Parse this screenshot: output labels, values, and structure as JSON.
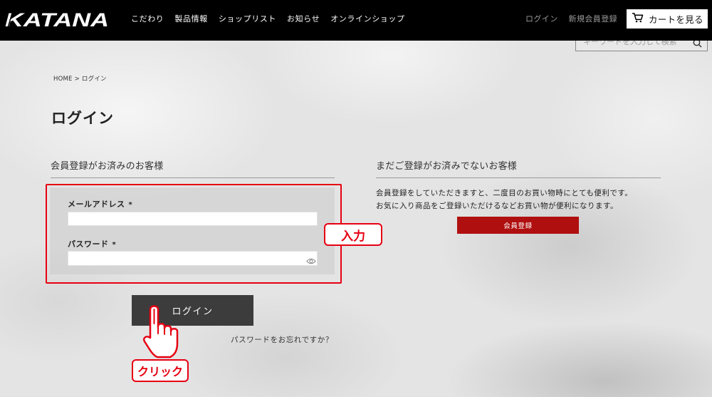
{
  "header": {
    "logo": "KATANA",
    "nav": [
      "こだわり",
      "製品情報",
      "ショップリスト",
      "お知らせ",
      "オンラインショップ"
    ],
    "login_link": "ログイン",
    "register_link": "新規会員登録",
    "cart_button": "カートを見る"
  },
  "search": {
    "placeholder": "キーワードを入力して検索"
  },
  "breadcrumb": {
    "home": "HOME",
    "separator": ">",
    "current": "ログイン"
  },
  "page_title": "ログイン",
  "member_login": {
    "heading": "会員登録がお済みのお客様",
    "email_label": "メールアドレス",
    "password_label": "パスワード",
    "required_mark": "*",
    "submit_button": "ログイン",
    "forgot_password_link": "パスワードをお忘れですか？"
  },
  "new_customer": {
    "heading": "まだご登録がお済みでないお客様",
    "description": [
      "会員登録をしていただきますと、二度目のお買い物時にとても便利です。",
      "お気に入り商品をご登録いただけるなどお買い物が便利になります。"
    ],
    "register_button": "会員登録"
  },
  "annotations": {
    "input_callout": "入力",
    "click_callout": "クリック"
  },
  "icons": {
    "cart": "cart-icon",
    "search": "search-icon",
    "password_toggle": "eye-icon",
    "pointer": "hand-pointer-icon"
  },
  "colors": {
    "header_bg": "#000000",
    "annotation": "#e60012",
    "login_button": "#3c3c3c",
    "register_button": "#b00f0f"
  }
}
